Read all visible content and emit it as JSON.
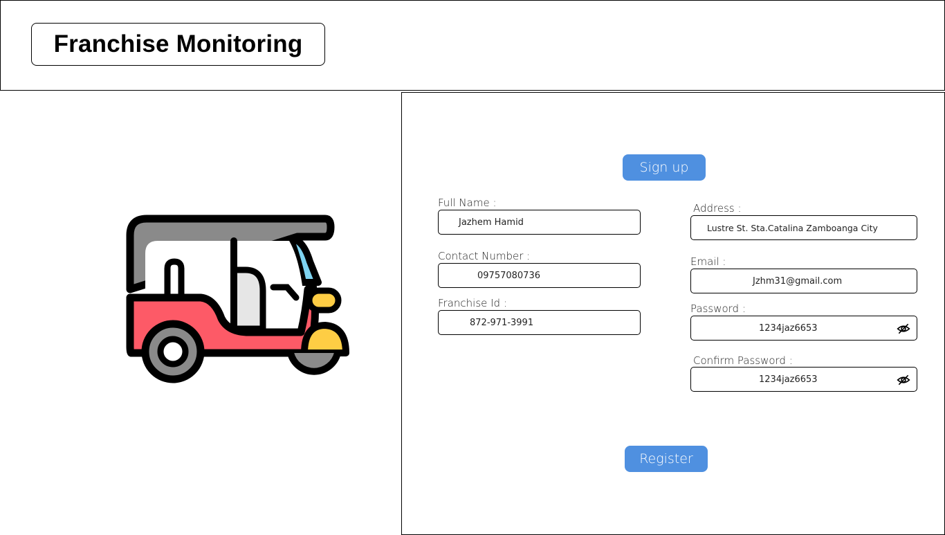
{
  "app": {
    "title": "Franchise Monitoring"
  },
  "illustration": {
    "icon": "auto-rickshaw-icon"
  },
  "form": {
    "heading_button": "Sign up",
    "fields": {
      "full_name": {
        "label": "Full Name :",
        "value": "Jazhem Hamid"
      },
      "contact_number": {
        "label": "Contact Number :",
        "value": "09757080736"
      },
      "franchise_id": {
        "label": "Franchise Id :",
        "value": "872-971-3991"
      },
      "address": {
        "label": "Address :",
        "value": "Lustre St. Sta.Catalina Zamboanga City"
      },
      "email": {
        "label": "Email :",
        "value": "Jzhm31@gmail.com"
      },
      "password": {
        "label": "Password :",
        "value": "1234jaz6653",
        "icon": "eye-slash-icon"
      },
      "confirm_password": {
        "label": "Confirm Password :",
        "value": "1234jaz6653",
        "icon": "eye-slash-icon"
      }
    },
    "submit_button": "Register"
  },
  "colors": {
    "accent": "#4f90e0",
    "vehicle_red": "#fd5a67",
    "vehicle_yellow": "#fecd44",
    "vehicle_gray": "#8a8a8a",
    "windshield_blue": "#7ed3f0"
  }
}
